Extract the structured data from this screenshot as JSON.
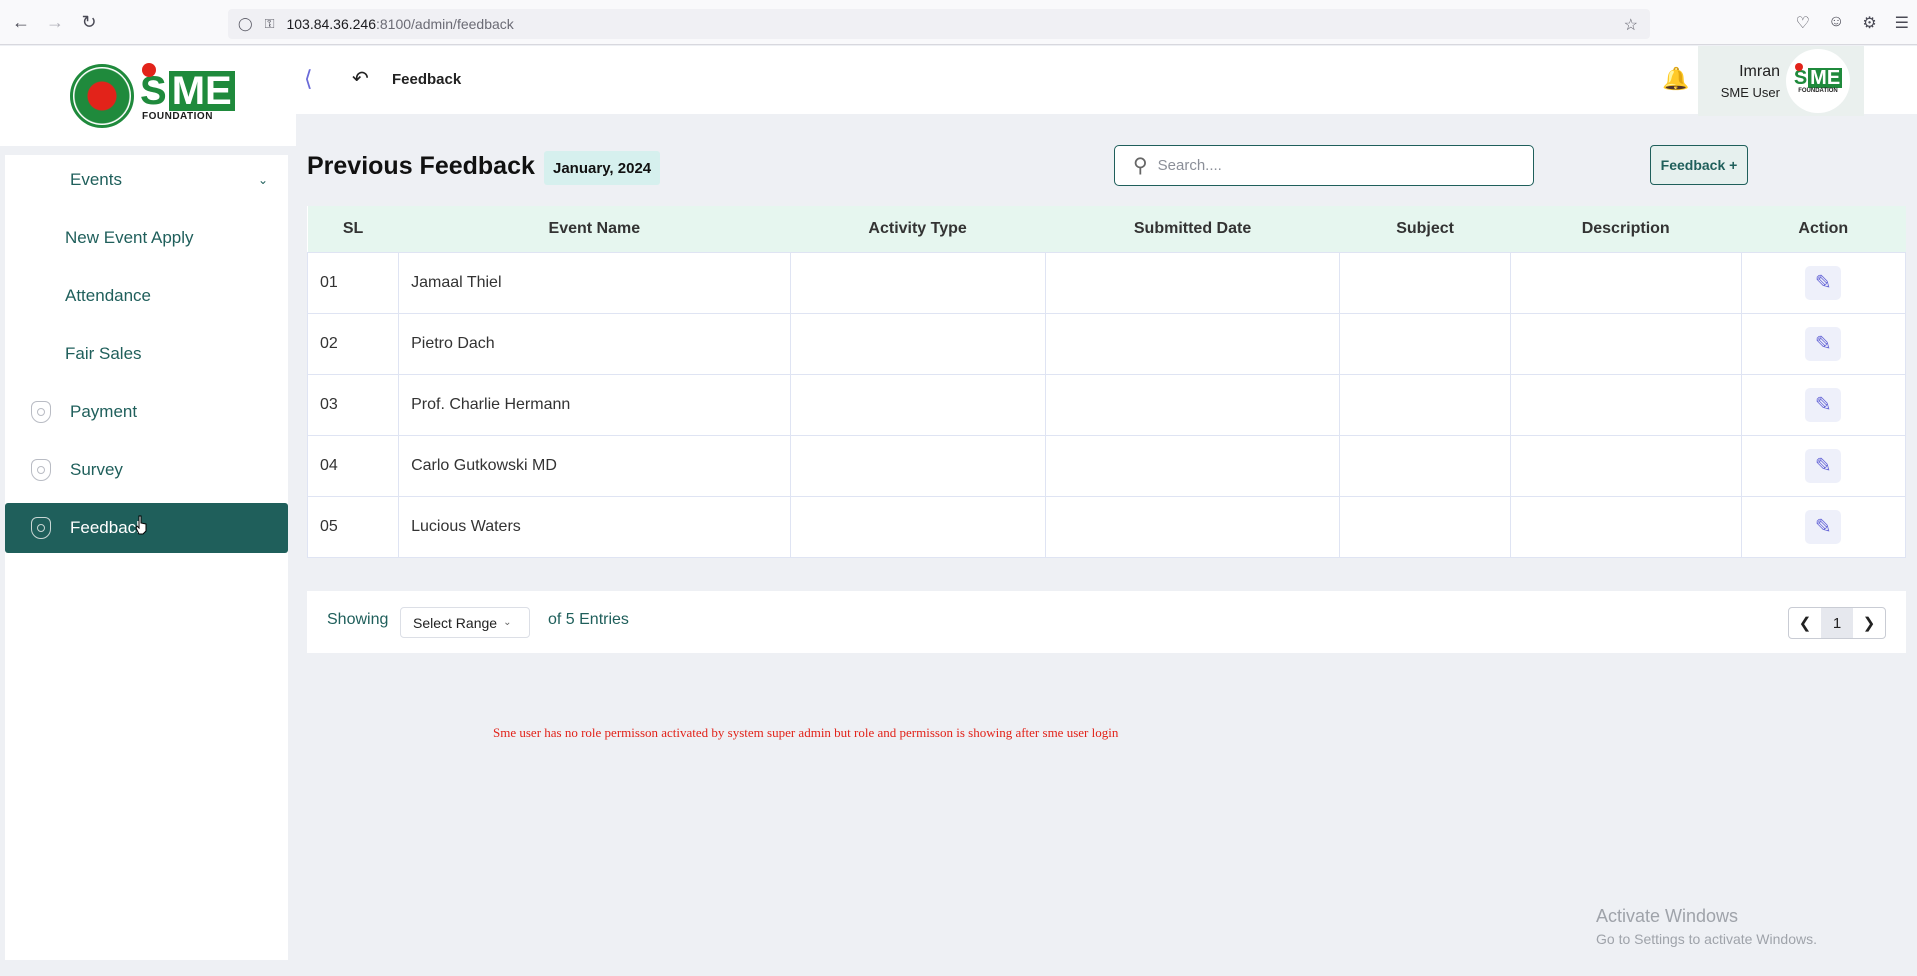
{
  "browser": {
    "url_host": "103.84.36.246",
    "url_path": ":8100/admin/feedback"
  },
  "sidebar": {
    "logo_foundation": "FOUNDATION",
    "items": [
      {
        "label": "Events"
      },
      {
        "label": "New Event Apply"
      },
      {
        "label": "Attendance"
      },
      {
        "label": "Fair Sales"
      },
      {
        "label": "Payment"
      },
      {
        "label": "Survey"
      },
      {
        "label": "Feedback"
      }
    ]
  },
  "header": {
    "title": "Feedback",
    "user_name": "Imran",
    "user_role": "SME User"
  },
  "main": {
    "heading": "Previous Feedback",
    "date_badge": "January, 2024",
    "search_placeholder": "Search....",
    "add_button": "Feedback +",
    "table": {
      "columns": [
        "SL",
        "Event Name",
        "Activity Type",
        "Submitted Date",
        "Subject",
        "Description",
        "Action"
      ],
      "rows": [
        {
          "sl": "01",
          "event": "Jamaal Thiel"
        },
        {
          "sl": "02",
          "event": "Pietro Dach"
        },
        {
          "sl": "03",
          "event": "Prof. Charlie Hermann"
        },
        {
          "sl": "04",
          "event": "Carlo Gutkowski MD"
        },
        {
          "sl": "05",
          "event": "Lucious Waters"
        }
      ]
    },
    "pagination": {
      "showing": "Showing",
      "range_select": "Select Range",
      "entries": "of 5 Entries",
      "current_page": "1"
    },
    "note": "Sme user has no role permisson activated by system super admin but role and permisson is showing after sme user login"
  },
  "watermark": {
    "line1": "Activate Windows",
    "line2": "Go to Settings to activate Windows."
  },
  "colors": {
    "primary": "#1f5f5b",
    "header_row": "#e6f6ef",
    "note_red": "#e2231a",
    "accent_purple": "#6a6ad8"
  }
}
